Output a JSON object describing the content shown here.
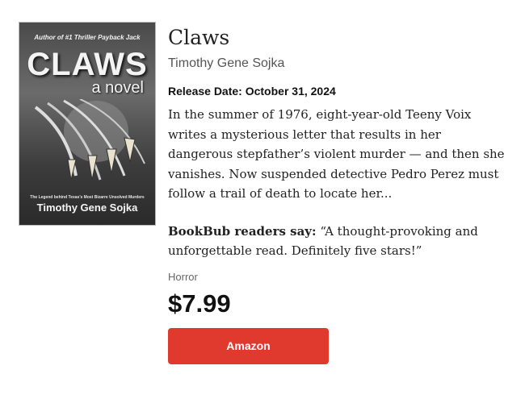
{
  "book": {
    "cover": {
      "author_line": "Author of #1 Thriller Payback Jack",
      "title": "CLAWS",
      "subtitle": "a novel",
      "tagline": "The Legend behind Texas's Most Bizarre Unsolved Murders",
      "author": "Timothy Gene Sojka"
    },
    "title": "Claws",
    "author": "Timothy Gene Sojka",
    "release_label": "Release Date:",
    "release_date": "October 31, 2024",
    "description": "In the summer of 1976, eight-year-old Teeny Voix writes a mysterious letter that results in her dangerous stepfather’s violent murder — and then she vanishes. Now suspended detective Pedro Perez must follow a trail of death to locate her...",
    "quote_label": "BookBub readers say:",
    "quote_text": "“A thought-provoking and unforgettable read. Definitely five stars!”",
    "genre": "Horror",
    "price": "$7.99",
    "buy_label": "Amazon",
    "colors": {
      "button": "#e0392d",
      "button_text": "#ffffff"
    }
  }
}
